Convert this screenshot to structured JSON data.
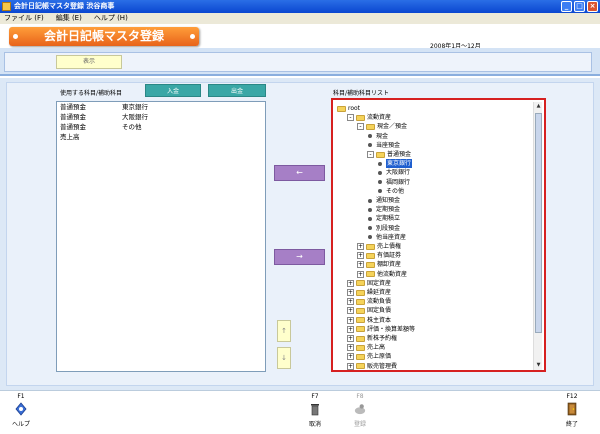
{
  "window": {
    "title": "会計日記帳マスタ登録 渋谷商事"
  },
  "menu": [
    "ファイル (F)",
    "編集 (E)",
    "ヘルプ (H)"
  ],
  "header": {
    "title": "会計日記帳マスタ登録",
    "period": "2008年1月～12月"
  },
  "toolbar": {
    "show_label": "表示"
  },
  "left": {
    "title": "使用する科目/補助科目",
    "btn_deposit": "入金",
    "btn_withdraw": "出金",
    "rows": [
      [
        "普通預金",
        "東京銀行"
      ],
      [
        "普通預金",
        "大阪銀行"
      ],
      [
        "普通預金",
        "その他"
      ],
      [
        "売上高",
        ""
      ]
    ]
  },
  "middle": {
    "left_arrow": "←",
    "right_arrow": "→",
    "up": "↑",
    "down": "↓"
  },
  "right": {
    "title": "科目/補助科目リスト",
    "tree": [
      {
        "label": "root",
        "depth": 0,
        "type": "folder",
        "exp": ""
      },
      {
        "label": "流動資産",
        "depth": 1,
        "type": "folder",
        "exp": "-"
      },
      {
        "label": "現金／預金",
        "depth": 2,
        "type": "folder",
        "exp": "-"
      },
      {
        "label": "現金",
        "depth": 3,
        "type": "leaf",
        "exp": ""
      },
      {
        "label": "当座預金",
        "depth": 3,
        "type": "leaf",
        "exp": ""
      },
      {
        "label": "普通預金",
        "depth": 3,
        "type": "folder",
        "exp": "-"
      },
      {
        "label": "東京銀行",
        "depth": 4,
        "type": "leaf",
        "exp": "",
        "selected": true
      },
      {
        "label": "大阪銀行",
        "depth": 4,
        "type": "leaf",
        "exp": ""
      },
      {
        "label": "福岡銀行",
        "depth": 4,
        "type": "leaf",
        "exp": ""
      },
      {
        "label": "その他",
        "depth": 4,
        "type": "leaf",
        "exp": ""
      },
      {
        "label": "通知預金",
        "depth": 3,
        "type": "leaf",
        "exp": ""
      },
      {
        "label": "定期預金",
        "depth": 3,
        "type": "leaf",
        "exp": ""
      },
      {
        "label": "定期積立",
        "depth": 3,
        "type": "leaf",
        "exp": ""
      },
      {
        "label": "別段預金",
        "depth": 3,
        "type": "leaf",
        "exp": ""
      },
      {
        "label": "他当座資産",
        "depth": 3,
        "type": "leaf",
        "exp": ""
      },
      {
        "label": "売上債権",
        "depth": 2,
        "type": "folder",
        "exp": "+"
      },
      {
        "label": "有価証券",
        "depth": 2,
        "type": "folder",
        "exp": "+"
      },
      {
        "label": "棚卸資産",
        "depth": 2,
        "type": "folder",
        "exp": "+"
      },
      {
        "label": "他流動資産",
        "depth": 2,
        "type": "folder",
        "exp": "+"
      },
      {
        "label": "固定資産",
        "depth": 1,
        "type": "folder",
        "exp": "+"
      },
      {
        "label": "繰延資産",
        "depth": 1,
        "type": "folder",
        "exp": "+"
      },
      {
        "label": "流動負債",
        "depth": 1,
        "type": "folder",
        "exp": "+"
      },
      {
        "label": "固定負債",
        "depth": 1,
        "type": "folder",
        "exp": "+"
      },
      {
        "label": "株主資本",
        "depth": 1,
        "type": "folder",
        "exp": "+"
      },
      {
        "label": "評価・換算差額等",
        "depth": 1,
        "type": "folder",
        "exp": "+"
      },
      {
        "label": "新株予約権",
        "depth": 1,
        "type": "folder",
        "exp": "+"
      },
      {
        "label": "売上高",
        "depth": 1,
        "type": "folder",
        "exp": "+"
      },
      {
        "label": "売上原価",
        "depth": 1,
        "type": "folder",
        "exp": "+"
      },
      {
        "label": "販売管理費",
        "depth": 1,
        "type": "folder",
        "exp": "+"
      }
    ]
  },
  "footer": {
    "help": {
      "key": "F1",
      "label": "ヘルプ"
    },
    "cancel": {
      "key": "F7",
      "label": "取消"
    },
    "register": {
      "key": "F8",
      "label": "登録"
    },
    "exit": {
      "key": "F12",
      "label": "終了"
    }
  },
  "colors": {
    "title_blue": "#0a46d0",
    "banner_orange": "#e8631a",
    "teal": "#3aa7a6",
    "purple": "#a67fc6",
    "select_red": "#d62020"
  }
}
